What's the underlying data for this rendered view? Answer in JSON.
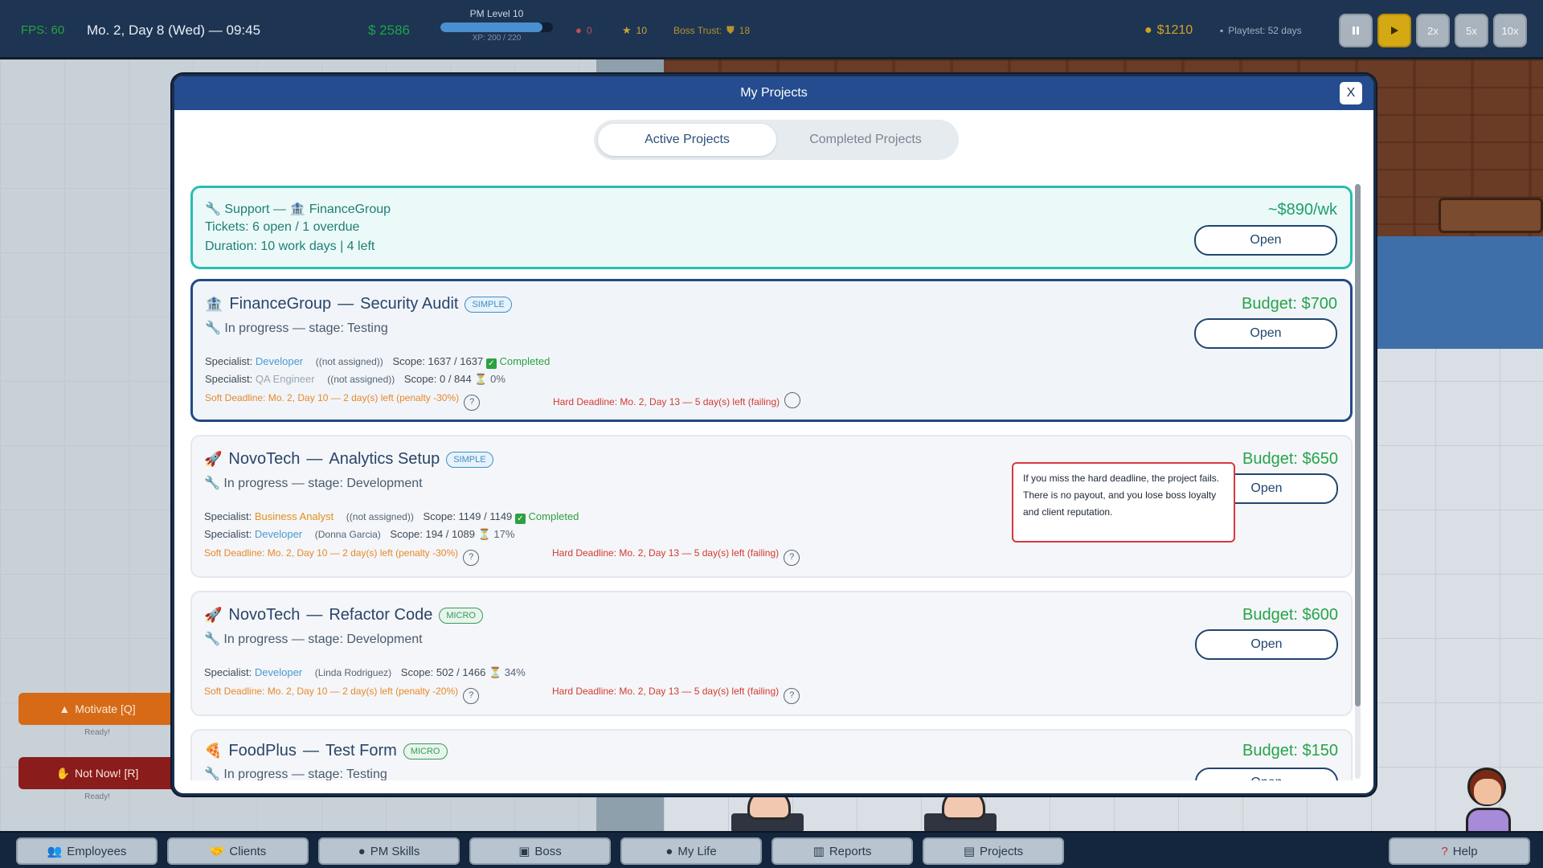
{
  "hud": {
    "fps": "FPS: 60",
    "date": "Mo. 2, Day 8 (Wed) — 09:45",
    "cash": "$ 2586",
    "pm_level": "PM Level 10",
    "xp": "XP: 200 / 220",
    "xp_progress": 0.91,
    "brain_value": "0",
    "star_value": "10",
    "boss_trust": "Boss Trust: ",
    "boss_trust_value": "18",
    "money": "$1210",
    "playtest": "Playtest: 52 days",
    "speeds": [
      "2x",
      "5x",
      "10x"
    ]
  },
  "modal": {
    "title": "My Projects",
    "close": "X",
    "tabs": [
      "Active Projects",
      "Completed Projects"
    ]
  },
  "support": {
    "header": "Support — ",
    "client": "FinanceGroup",
    "tickets": "Tickets: 6 open / 1 overdue",
    "duration": "Duration: 10 work days | 4 left",
    "rate": "~$890/wk",
    "open": "Open"
  },
  "projects": [
    {
      "client": "FinanceGroup",
      "sep": "—",
      "name": "Security Audit",
      "badge": "SIMPLE",
      "stage": "In progress — stage: Testing",
      "budget": "Budget: $700",
      "open": "Open",
      "specialists": [
        {
          "label": "Specialist:",
          "role": "Developer",
          "assignee": "((not assigned))",
          "scope": "Scope: 1637 / 1637",
          "status": "Completed"
        },
        {
          "label": "Specialist:",
          "role": "QA Engineer",
          "assignee": "((not assigned))",
          "scope": "Scope: 0 / 844",
          "status": "0%"
        }
      ],
      "soft": "Soft Deadline: Mo. 2, Day 10 — 2 day(s) left (penalty -30%)",
      "hard": "Hard Deadline: Mo. 2, Day 13 — 5 day(s) left (failing)"
    },
    {
      "client": "NovoTech",
      "sep": "—",
      "name": "Analytics Setup",
      "badge": "SIMPLE",
      "stage": "In progress — stage: Development",
      "budget": "Budget: $650",
      "open": "Open",
      "specialists": [
        {
          "label": "Specialist:",
          "role": "Business Analyst",
          "assignee": "((not assigned))",
          "scope": "Scope: 1149 / 1149",
          "status": "Completed"
        },
        {
          "label": "Specialist:",
          "role": "Developer",
          "assignee": "(Donna Garcia)",
          "scope": "Scope: 194 / 1089",
          "status": "17%"
        }
      ],
      "soft": "Soft Deadline: Mo. 2, Day 10 — 2 day(s) left (penalty -30%)",
      "hard": "Hard Deadline: Mo. 2, Day 13 — 5 day(s) left (failing)"
    },
    {
      "client": "NovoTech",
      "sep": "—",
      "name": "Refactor Code",
      "badge": "MICRO",
      "stage": "In progress — stage: Development",
      "budget": "Budget: $600",
      "open": "Open",
      "specialists": [
        {
          "label": "Specialist:",
          "role": "Developer",
          "assignee": "(Linda Rodriguez)",
          "scope": "Scope: 502 / 1466",
          "status": "34%"
        }
      ],
      "soft": "Soft Deadline: Mo. 2, Day 10 — 2 day(s) left (penalty -20%)",
      "hard": "Hard Deadline: Mo. 2, Day 13 — 5 day(s) left (failing)"
    },
    {
      "client": "FoodPlus",
      "sep": "—",
      "name": "Test Form",
      "badge": "MICRO",
      "stage": "In progress — stage: Testing",
      "budget": "Budget: $150",
      "open": "Open"
    }
  ],
  "tooltip": "If you miss the hard deadline, the project fails. There is no payout, and you lose boss loyalty and client reputation.",
  "qmark": "?",
  "side": {
    "motivate": "Motivate [Q]",
    "motivate_ready": "Ready!",
    "notnow": "Not Now! [R]",
    "notnow_ready": "Ready!"
  },
  "nav": [
    "Employees",
    "Clients",
    "PM Skills",
    "Boss",
    "My Life",
    "Reports",
    "Projects",
    "Help"
  ]
}
